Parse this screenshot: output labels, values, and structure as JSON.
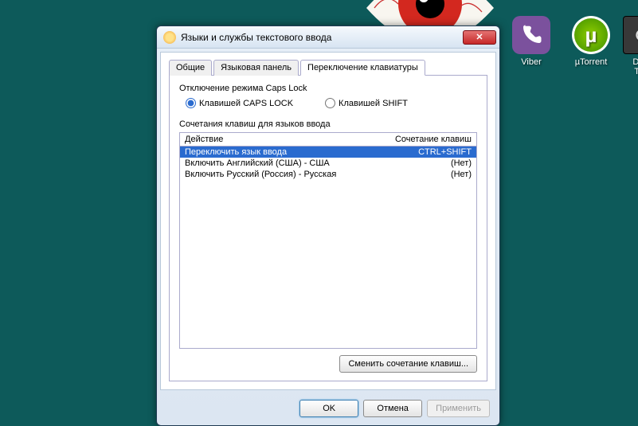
{
  "desktop": {
    "icons": [
      {
        "name": "viber-app",
        "label": "Viber"
      },
      {
        "name": "utorrent-app",
        "label": "µTorrent"
      },
      {
        "name": "daemon-tools-app",
        "label": "DA\nTo"
      }
    ]
  },
  "window": {
    "title": "Языки и службы текстового ввода",
    "tabs": {
      "general": "Общие",
      "langbar": "Языковая панель",
      "switch": "Переключение клавиатуры"
    },
    "caps": {
      "group": "Отключение режима Caps Lock",
      "opt_caps": "Клавишей CAPS LOCK",
      "opt_shift": "Клавишей SHIFT"
    },
    "shortcuts": {
      "group": "Сочетания клавиш для языков ввода",
      "col_action": "Действие",
      "col_combo": "Сочетание клавиш",
      "rows": [
        {
          "action": "Переключить язык ввода",
          "combo": "CTRL+SHIFT"
        },
        {
          "action": "Включить Английский (США) - США",
          "combo": "(Нет)"
        },
        {
          "action": "Включить Русский (Россия) - Русская",
          "combo": "(Нет)"
        }
      ],
      "change_btn": "Сменить сочетание клавиш..."
    },
    "actions": {
      "ok": "OK",
      "cancel": "Отмена",
      "apply": "Применить"
    }
  }
}
